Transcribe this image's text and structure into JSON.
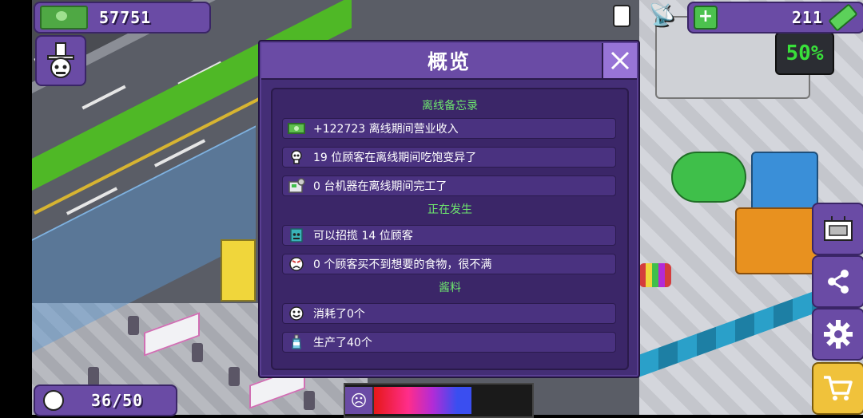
{
  "hud": {
    "money": "57751",
    "energy": "211",
    "customers": "36/50"
  },
  "dialog": {
    "title": "概览",
    "sections": [
      {
        "title": "离线备忘录",
        "rows": [
          {
            "icon": "cash-icon",
            "text": "+122723 离线期间营业收入"
          },
          {
            "icon": "skull-icon",
            "text": "19 位顾客在离线期间吃饱变异了"
          },
          {
            "icon": "machine-icon",
            "text": "0 台机器在离线期间完工了"
          }
        ]
      },
      {
        "title": "正在发生",
        "rows": [
          {
            "icon": "customer-recruit-icon",
            "text": "可以招揽 14 位顾客"
          },
          {
            "icon": "angry-face-icon",
            "text": "0 个顾客买不到想要的食物，很不满"
          }
        ]
      },
      {
        "title": "酱料",
        "rows": [
          {
            "icon": "happy-face-icon",
            "text": "消耗了0个"
          },
          {
            "icon": "sauce-bottle-icon",
            "text": "生产了40个"
          }
        ]
      }
    ]
  },
  "colors": {
    "panel": "#6a4ba5",
    "dialog": "#442e76",
    "section_title": "#6ee66e",
    "close_button": "#9774d6"
  }
}
